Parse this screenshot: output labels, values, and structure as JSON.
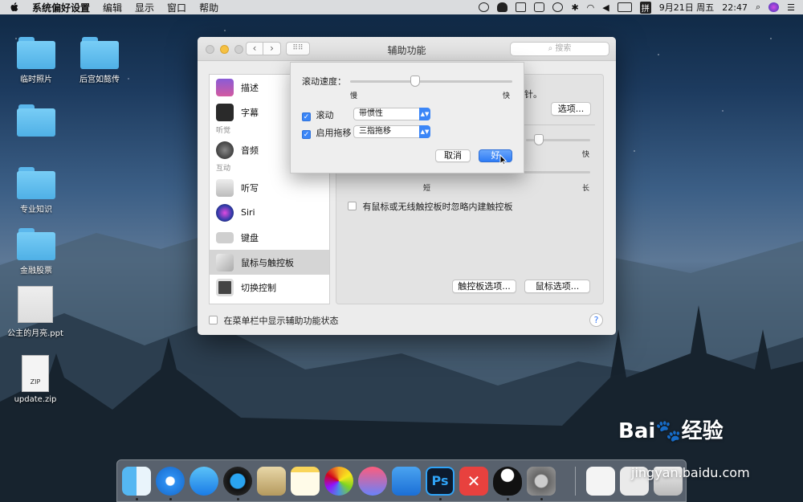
{
  "menubar": {
    "app": "系统偏好设置",
    "items": [
      "编辑",
      "显示",
      "窗口",
      "帮助"
    ],
    "date": "9月21日 周五",
    "time": "22:47",
    "input_method": "拼"
  },
  "desktop": {
    "icons": [
      "临时照片",
      "后宫如懿传",
      "",
      "专业知识",
      "金融股票",
      "公主的月亮.ppt",
      "update.zip"
    ],
    "zip_badge": "ZIP"
  },
  "window": {
    "title": "辅助功能",
    "search_placeholder": "搜索",
    "sidebar": {
      "items": [
        {
          "label": "描述",
          "icon": "description-icon"
        },
        {
          "label": "字幕",
          "icon": "captions-icon"
        },
        {
          "header": "听觉"
        },
        {
          "label": "音频",
          "icon": "speaker-icon"
        },
        {
          "header": "互动"
        },
        {
          "label": "听写",
          "icon": "microphone-icon"
        },
        {
          "label": "Siri",
          "icon": "siri-icon"
        },
        {
          "label": "键盘",
          "icon": "keyboard-icon"
        },
        {
          "label": "鼠标与触控板",
          "icon": "trackpad-icon",
          "selected": true
        },
        {
          "label": "切换控制",
          "icon": "switch-control-icon"
        }
      ]
    },
    "panel": {
      "partial_text": "针。",
      "options_button": "选项...",
      "speed_fast": "快",
      "delay_short": "短",
      "delay_long": "长",
      "ignore_trackpad": "有鼠标或无线触控板时忽略内建触控板",
      "trackpad_options": "触控板选项...",
      "mouse_options": "鼠标选项..."
    },
    "show_status": "在菜单栏中显示辅助功能状态",
    "help": "?"
  },
  "sheet": {
    "scroll_speed_label": "滚动速度：",
    "slow": "慢",
    "fast": "快",
    "scroll_speed_value": 0.4,
    "scroll_label": "滚动",
    "scroll_value": "带惯性",
    "drag_label": "启用拖移",
    "drag_value": "三指拖移",
    "cancel": "取消",
    "ok": "好"
  },
  "watermark": {
    "brand": "Bai",
    "brand2": "经验",
    "url": "jingyan.baidu.com"
  }
}
